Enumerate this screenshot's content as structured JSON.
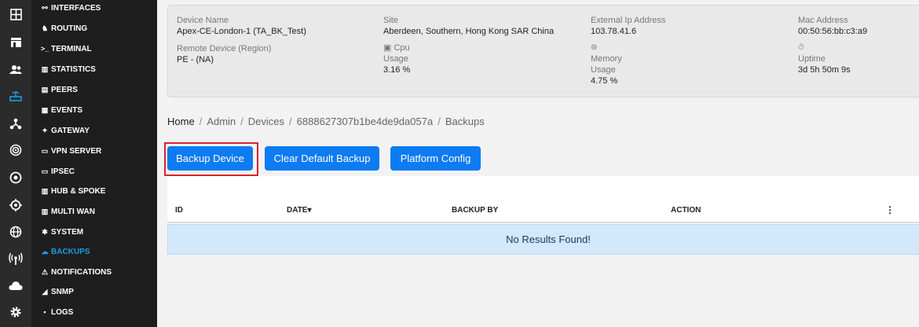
{
  "rail": {
    "icons": [
      "grid-icon",
      "store-icon",
      "users-icon",
      "router-icon",
      "network-icon",
      "radar-icon",
      "target-icon",
      "crosshair-icon",
      "globe-icon",
      "antenna-icon",
      "cloud-icon",
      "gear-icon"
    ],
    "active_index": 3
  },
  "submenu": {
    "items": [
      {
        "label": "INTERFACES",
        "icon": "⚯"
      },
      {
        "label": "ROUTING",
        "icon": "♞"
      },
      {
        "label": "TERMINAL",
        "icon": ">_"
      },
      {
        "label": "STATISTICS",
        "icon": "▥"
      },
      {
        "label": "PEERS",
        "icon": "▤"
      },
      {
        "label": "EVENTS",
        "icon": "▦"
      },
      {
        "label": "GATEWAY",
        "icon": "✦"
      },
      {
        "label": "VPN SERVER",
        "icon": "▭"
      },
      {
        "label": "IPSEC",
        "icon": "▭"
      },
      {
        "label": "HUB & SPOKE",
        "icon": "▥"
      },
      {
        "label": "MULTI WAN",
        "icon": "▥"
      },
      {
        "label": "SYSTEM",
        "icon": "✱"
      },
      {
        "label": "BACKUPS",
        "icon": "☁"
      },
      {
        "label": "NOTIFICATIONS",
        "icon": "⚠"
      },
      {
        "label": "SNMP",
        "icon": "◢"
      },
      {
        "label": "LOGS",
        "icon": "▪"
      }
    ],
    "active_index": 12
  },
  "device": {
    "name_label": "Device Name",
    "name_value": "Apex-CE-London-1 (TA_BK_Test)",
    "remote_label": "Remote Device (Region)",
    "remote_value": "PE - (NA)",
    "site_label": "Site",
    "site_value": "Aberdeen, Southern, Hong Kong SAR China",
    "cpu_label": "Cpu",
    "cpu_usage_label": "Usage",
    "cpu_value": "3.16 %",
    "ext_ip_label": "External Ip Address",
    "ext_ip_value": "103.78.41.6",
    "memory_label": "Memory",
    "memory_usage_label": "Usage",
    "memory_value": "4.75 %",
    "mac_label": "Mac Address",
    "mac_value": "00:50:56:bb:c3:a9",
    "uptime_label": "Uptime",
    "uptime_value": "3d 5h 50m 9s"
  },
  "breadcrumb": [
    "Home",
    "Admin",
    "Devices",
    "6888627307b1be4de9da057a",
    "Backups"
  ],
  "buttons": {
    "backup": "Backup Device",
    "clear": "Clear Default Backup",
    "platform": "Platform Config"
  },
  "table": {
    "columns": [
      "ID",
      "DATE",
      "BACKUP BY",
      "ACTION"
    ],
    "sort_indicator": "▾",
    "empty_message": "No Results Found!"
  },
  "colors": {
    "accent": "#0d7bf2",
    "active_menu": "#1e9be9",
    "highlight": "#d9232d"
  }
}
